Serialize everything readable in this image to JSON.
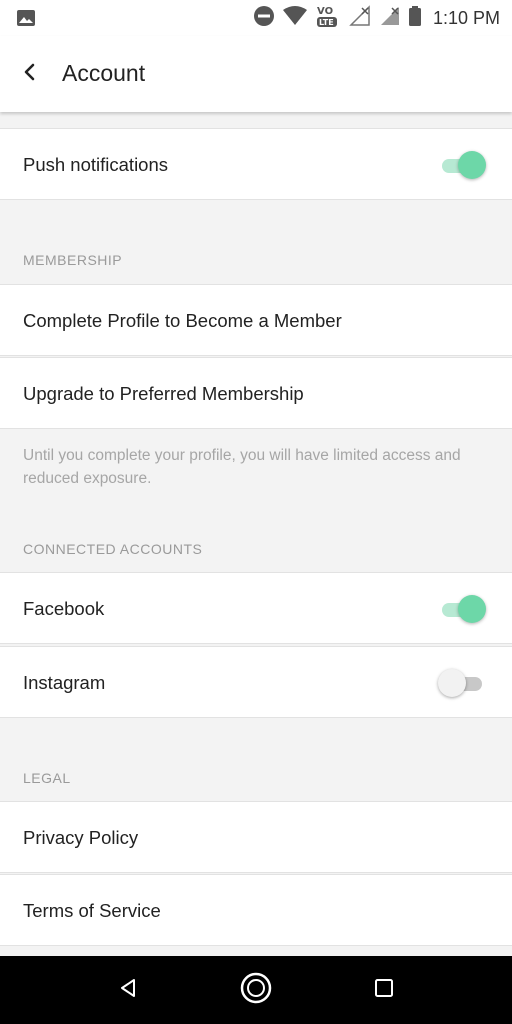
{
  "status_bar": {
    "time": "1:10 PM",
    "icons": [
      "image-icon",
      "do-not-disturb-icon",
      "wifi-icon",
      "volte-icon",
      "signal-icon",
      "signal-icon",
      "battery-icon"
    ]
  },
  "app_bar": {
    "title": "Account",
    "back_icon": "back-chevron-icon"
  },
  "settings": {
    "push_notifications": {
      "label": "Push notifications",
      "enabled": true
    },
    "membership": {
      "header": "MEMBERSHIP",
      "items": [
        {
          "label": "Complete Profile to Become a Member"
        },
        {
          "label": "Upgrade to Preferred Membership"
        }
      ],
      "note": "Until you complete your profile, you will have limited access and reduced exposure."
    },
    "connected_accounts": {
      "header": "CONNECTED ACCOUNTS",
      "items": [
        {
          "label": "Facebook",
          "enabled": true
        },
        {
          "label": "Instagram",
          "enabled": false
        }
      ]
    },
    "legal": {
      "header": "LEGAL",
      "items": [
        {
          "label": "Privacy Policy"
        },
        {
          "label": "Terms of Service"
        }
      ]
    }
  },
  "nav_bar": {
    "icons": [
      "back-triangle-icon",
      "home-circle-icon",
      "recents-square-icon"
    ]
  },
  "colors": {
    "accent": "#6dd7a8",
    "accent_track": "#b7e9d3",
    "background": "#f3f3f3",
    "row_background": "#ffffff",
    "section_header": "#9a9a9a"
  }
}
